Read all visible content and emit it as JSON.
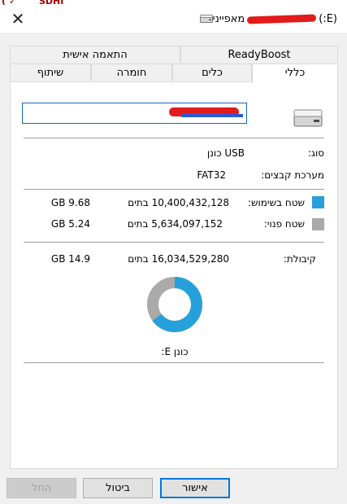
{
  "window": {
    "title_label": "מאפייני",
    "title_drive": "(E:)",
    "close_glyph": "✕"
  },
  "tabs_row1": [
    {
      "label": "ReadyBoost"
    },
    {
      "label": "התאמה אישית"
    }
  ],
  "tabs_row2": [
    {
      "label": "כללי",
      "active": true
    },
    {
      "label": "כלים"
    },
    {
      "label": "חומרה"
    },
    {
      "label": "שיתוף"
    }
  ],
  "general": {
    "type_label": "סוג:",
    "type_value": "USB כונן",
    "fs_label": "מערכת קבצים:",
    "fs_value": "FAT32",
    "used_label": "שטח בשימוש:",
    "used_bytes": "10,400,432,128 בתים",
    "used_gb": "9.68 GB",
    "free_label": "שטח פנוי:",
    "free_bytes": "5,634,097,152 בתים",
    "free_gb": "5.24 GB",
    "cap_label": "קיבולת:",
    "cap_bytes": "16,034,529,280 בתים",
    "cap_gb": "14.9 GB",
    "drive_label": "כונן E:"
  },
  "usage": {
    "used_fraction": 0.649
  },
  "colors": {
    "used": "#26a0da",
    "free": "#aaaaaa",
    "accent": "#0078d7"
  },
  "buttons": {
    "ok": "אישור",
    "cancel": "ביטול",
    "apply": "החל"
  },
  "icons": [
    "close-icon",
    "drive-icon"
  ]
}
